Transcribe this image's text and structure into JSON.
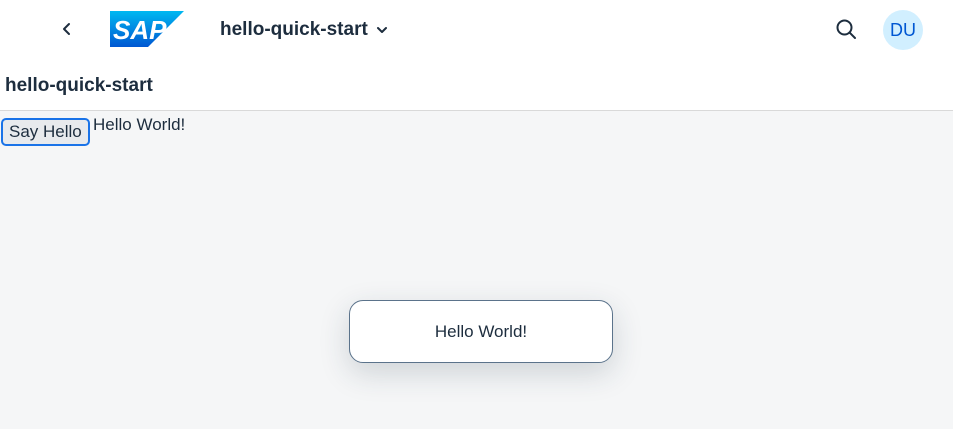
{
  "shellbar": {
    "logo_text": "SAP",
    "app_title": "hello-quick-start",
    "avatar_initials": "DU",
    "icons": {
      "back": "chevron-left-icon",
      "title_menu": "chevron-down-icon",
      "search": "search-icon"
    }
  },
  "page": {
    "title": "hello-quick-start"
  },
  "content": {
    "button_label": "Say Hello",
    "output_text": "Hello World!"
  },
  "toast": {
    "message": "Hello World!"
  },
  "colors": {
    "logo_blue": "#0070f2",
    "avatar_bg": "#d1efff",
    "avatar_text": "#0057d2",
    "button_focus_border": "#1a73e8",
    "content_bg": "#f5f6f7"
  }
}
